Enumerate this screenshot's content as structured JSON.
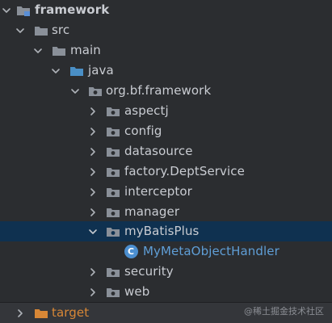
{
  "project_tree": {
    "root": {
      "label": "framework",
      "icon": "module-folder-icon",
      "expanded": true
    },
    "items": [
      {
        "label": "src",
        "icon": "folder-icon",
        "expanded": true
      },
      {
        "label": "main",
        "icon": "folder-icon",
        "expanded": true
      },
      {
        "label": "java",
        "icon": "source-root-folder-icon",
        "expanded": true
      },
      {
        "label": "org.bf.framework",
        "icon": "package-icon",
        "expanded": true
      },
      {
        "label": "aspectj",
        "icon": "package-icon",
        "expanded": false
      },
      {
        "label": "config",
        "icon": "package-icon",
        "expanded": false
      },
      {
        "label": "datasource",
        "icon": "package-icon",
        "expanded": false
      },
      {
        "label": "factory.DeptService",
        "icon": "package-icon",
        "expanded": false
      },
      {
        "label": "interceptor",
        "icon": "package-icon",
        "expanded": false
      },
      {
        "label": "manager",
        "icon": "package-icon",
        "expanded": false
      },
      {
        "label": "myBatisPlus",
        "icon": "package-icon",
        "expanded": true,
        "selected": true
      },
      {
        "label": "MyMetaObjectHandler",
        "icon": "java-class-icon",
        "badge": "C"
      },
      {
        "label": "security",
        "icon": "package-icon",
        "expanded": false
      },
      {
        "label": "web",
        "icon": "package-icon",
        "expanded": false
      }
    ],
    "target": {
      "label": "target",
      "icon": "excluded-folder-icon",
      "expanded": false
    }
  },
  "colors": {
    "background": "#2b2d30",
    "selection": "#0f3150",
    "text": "#c9ccd2",
    "java_class_text": "#5f9ed6",
    "target_text": "#d88736",
    "folder_icon": "#8a9099",
    "source_root_icon": "#4a8fc6",
    "excluded_folder_icon": "#d88736"
  },
  "watermark": "@稀土掘金技术社区"
}
